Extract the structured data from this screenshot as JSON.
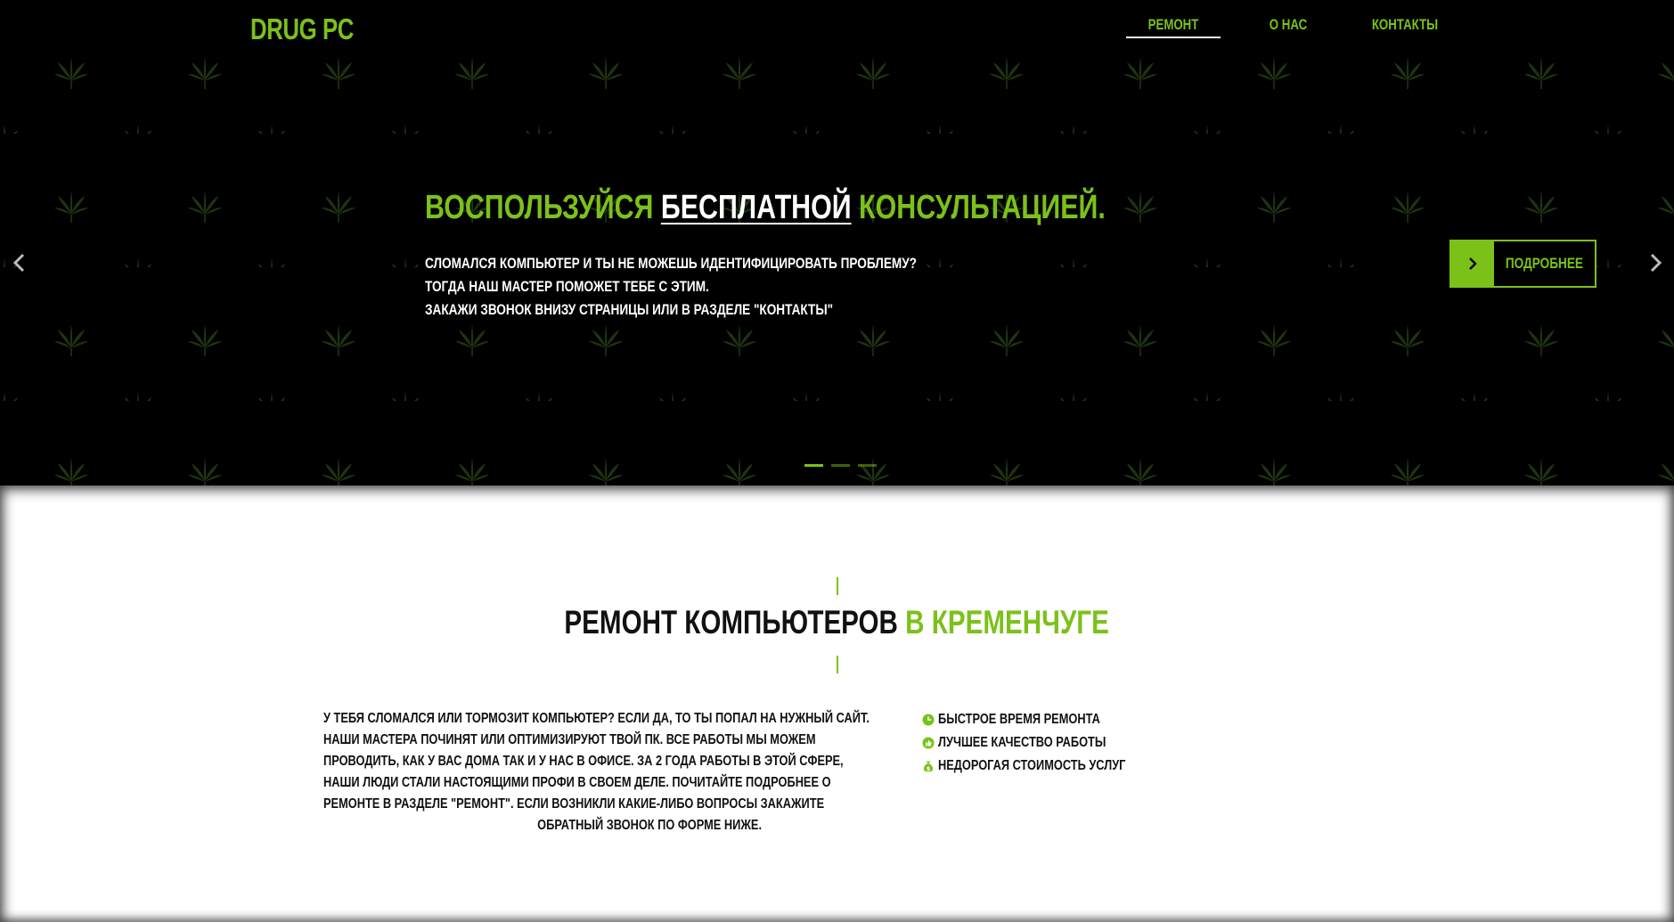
{
  "brand": "DRUG PC",
  "nav": {
    "items": [
      {
        "label": "РЕМОНТ",
        "active": true
      },
      {
        "label": "О НАС",
        "active": false
      },
      {
        "label": "КОНТАКТЫ",
        "active": false
      }
    ]
  },
  "hero": {
    "title_before": "ВОСПОЛЬЗУЙСЯ",
    "title_highlight": "БЕСПЛАТНОЙ",
    "title_after": "КОНСУЛЬТАЦИЕЙ.",
    "lines": [
      "СЛОМАЛСЯ КОМПЬЮТЕР И ТЫ НЕ МОЖЕШЬ ИДЕНТИФИЦИРОВАТЬ ПРОБЛЕМУ?",
      "ТОГДА НАШ МАСТЕР ПОМОЖЕТ ТЕБЕ С ЭТИМ.",
      "ЗАКАЖИ ЗВОНОК ВНИЗУ СТРАНИЦЫ ИЛИ В РАЗДЕЛЕ \"КОНТАКТЫ\""
    ],
    "button_label": "ПОДРОБНЕЕ",
    "slide_count": 3,
    "active_slide": 1
  },
  "section": {
    "title_main": "РЕМОНТ КОМПЬЮТЕРОВ",
    "title_accent": "В КРЕМЕНЧУГЕ",
    "about_lines": [
      "У ТЕБЯ СЛОМАЛСЯ ИЛИ ТОРМОЗИТ КОМПЬЮТЕР? ЕСЛИ ДА, ТО ТЫ ПОПАЛ НА НУЖНЫЙ САЙТ.",
      "НАШИ МАСТЕРА ПОЧИНЯТ ИЛИ ОПТИМИЗИРУЮТ ТВОЙ ПК. ВСЕ РАБОТЫ МЫ МОЖЕМ",
      "ПРОВОДИТЬ, КАК У ВАС ДОМА ТАК И У НАС В ОФИСЕ. ЗА 2 ГОДА РАБОТЫ В ЭТОЙ СФЕРЕ,",
      "НАШИ ЛЮДИ СТАЛИ НАСТОЯЩИМИ ПРОФИ В СВОЕМ ДЕЛЕ. ПОЧИТАЙТЕ ПОДРОБНЕЕ О",
      "РЕМОНТЕ В РАЗДЕЛЕ \"РЕМОНТ\". ЕСЛИ ВОЗНИКЛИ КАКИЕ-ЛИБО ВОПРОСЫ ЗАКАЖИТЕ",
      "ОБРАТНЫЙ ЗВОНОК ПО ФОРМЕ НИЖЕ."
    ],
    "features": [
      {
        "icon": "clock-icon",
        "label": "БЫСТРОЕ ВРЕМЯ РЕМОНТА"
      },
      {
        "icon": "thumbs-up-icon",
        "label": "ЛУЧШЕЕ КАЧЕСТВО РАБОТЫ"
      },
      {
        "icon": "money-bag-icon",
        "label": "НЕДОРОГАЯ СТОИМОСТЬ УСЛУГ"
      }
    ]
  },
  "colors": {
    "accent": "#7cc11a",
    "hero_bg": "#000000",
    "text_dark": "#111111"
  }
}
